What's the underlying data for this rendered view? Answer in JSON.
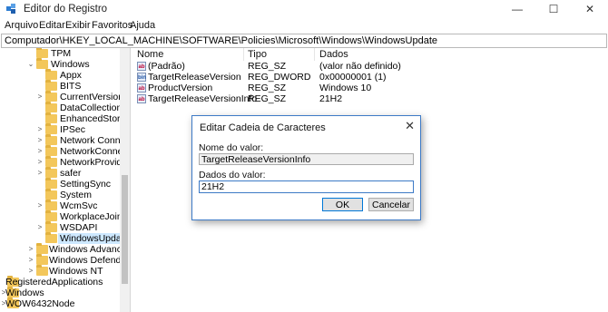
{
  "window": {
    "title": "Editor do Registro",
    "minimize_glyph": "—",
    "maximize_glyph": "☐",
    "close_glyph": "✕"
  },
  "menu": [
    "Arquivo",
    "Editar",
    "Exibir",
    "Favoritos",
    "Ajuda"
  ],
  "address": "Computador\\HKEY_LOCAL_MACHINE\\SOFTWARE\\Policies\\Microsoft\\Windows\\WindowsUpdate",
  "tree": [
    {
      "label": "TPM",
      "chevron": ""
    },
    {
      "label": "Windows",
      "chevron": "⌄"
    },
    {
      "label": "Appx",
      "chevron": ""
    },
    {
      "label": "BITS",
      "chevron": ""
    },
    {
      "label": "CurrentVersion",
      "chevron": ">"
    },
    {
      "label": "DataCollection",
      "chevron": ""
    },
    {
      "label": "EnhancedStorageD",
      "chevron": ""
    },
    {
      "label": "IPSec",
      "chevron": ">"
    },
    {
      "label": "Network Connectic",
      "chevron": ">"
    },
    {
      "label": "NetworkConnectivi",
      "chevron": ">"
    },
    {
      "label": "NetworkProvider",
      "chevron": ">"
    },
    {
      "label": "safer",
      "chevron": ">"
    },
    {
      "label": "SettingSync",
      "chevron": ""
    },
    {
      "label": "System",
      "chevron": ""
    },
    {
      "label": "WcmSvc",
      "chevron": ">"
    },
    {
      "label": "WorkplaceJoin",
      "chevron": ""
    },
    {
      "label": "WSDAPI",
      "chevron": ">"
    },
    {
      "label": "WindowsUpdate",
      "chevron": ""
    },
    {
      "label": "Windows Advanced Tl",
      "chevron": ">"
    },
    {
      "label": "Windows Defender",
      "chevron": ">"
    },
    {
      "label": "Windows NT",
      "chevron": ">"
    },
    {
      "label": "RegisteredApplications",
      "chevron": ""
    },
    {
      "label": "Windows",
      "chevron": ">"
    },
    {
      "label": "WOW6432Node",
      "chevron": ">"
    }
  ],
  "columns": {
    "name": "Nome",
    "type": "Tipo",
    "data": "Dados"
  },
  "values": [
    {
      "icon": "ab",
      "name": "(Padrão)",
      "type": "REG_SZ",
      "data": "(valor não definido)"
    },
    {
      "icon": "bin",
      "name": "TargetReleaseVersion",
      "type": "REG_DWORD",
      "data": "0x00000001 (1)"
    },
    {
      "icon": "ab",
      "name": "ProductVersion",
      "type": "REG_SZ",
      "data": "Windows 10"
    },
    {
      "icon": "ab",
      "name": "TargetReleaseVersionInfo",
      "type": "REG_SZ",
      "data": "21H2"
    }
  ],
  "dialog": {
    "title": "Editar Cadeia de Caracteres",
    "name_label": "Nome do valor:",
    "name_value": "TargetReleaseVersionInfo",
    "data_label": "Dados do valor:",
    "data_value": "21H2",
    "ok_label": "OK",
    "cancel_label": "Cancelar"
  }
}
